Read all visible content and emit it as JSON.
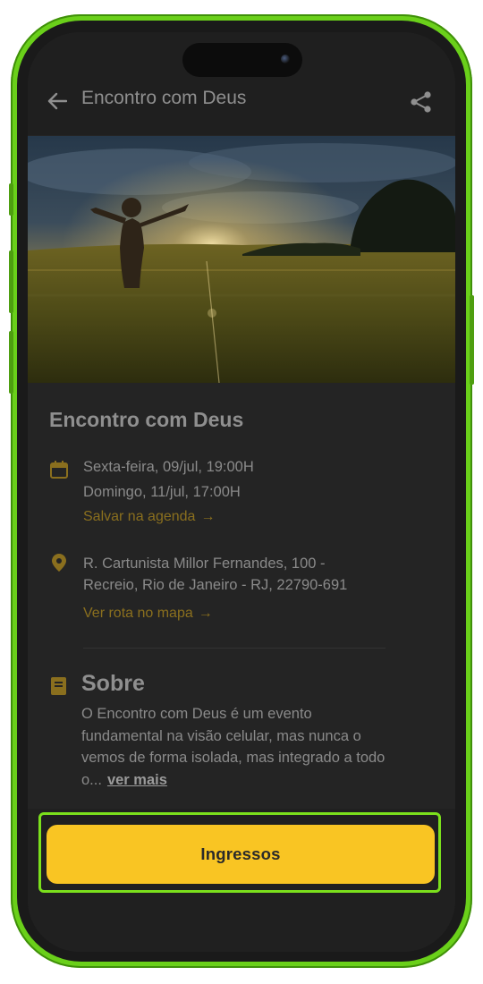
{
  "header": {
    "title": "Encontro com Deus",
    "back_icon": "arrow-left-icon",
    "share_icon": "share-icon"
  },
  "hero": {
    "image_description_icon": "hero-photo"
  },
  "event": {
    "title": "Encontro com Deus",
    "date_lines": [
      "Sexta-feira, 09/jul, 19:00H",
      "Domingo, 11/jul, 17:00H"
    ],
    "save_link": "Salvar na agenda",
    "address_lines": [
      "R. Cartunista Millor Fernandes, 100 -",
      "Recreio, Rio de Janeiro - RJ, 22790-691"
    ],
    "route_link": "Ver rota no mapa"
  },
  "about": {
    "heading": "Sobre",
    "body": "O Encontro com Deus é um evento fundamental na visão celular, mas nunca o vemos de forma isolada, mas integrado a todo o...",
    "more_link": "ver mais"
  },
  "cta": {
    "label": "Ingressos"
  },
  "colors": {
    "frame": "#6ad01a",
    "accent": "#f9c523",
    "highlight": "#7be01c",
    "link": "#8a6f1e"
  }
}
